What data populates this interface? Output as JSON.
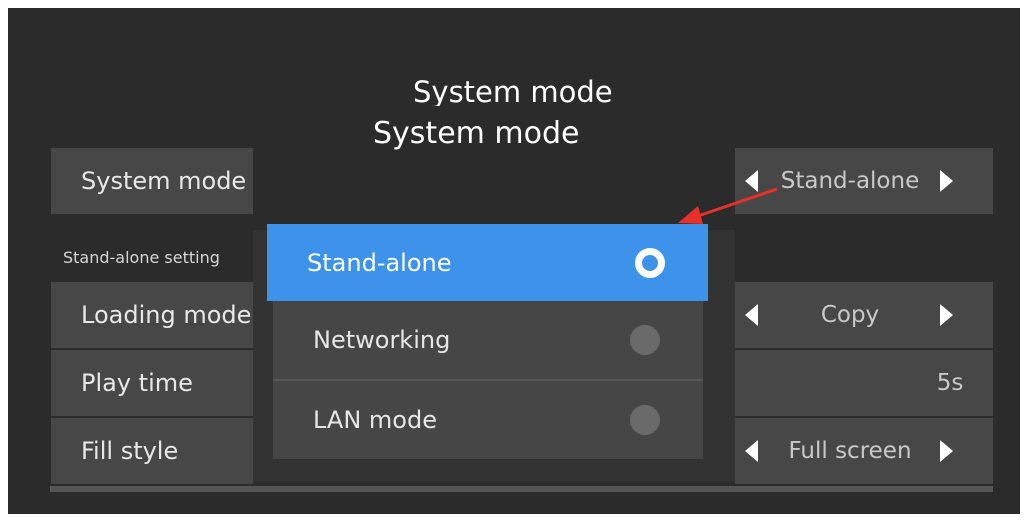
{
  "titles": {
    "top": "System mode",
    "main": "System mode"
  },
  "rows": {
    "system_mode": {
      "label": "System mode",
      "value": "Stand-alone"
    },
    "section": "Stand-alone setting",
    "loading_mode": {
      "label": "Loading mode",
      "value": "Copy"
    },
    "play_time": {
      "label": "Play time",
      "value": "5s"
    },
    "fill_style": {
      "label": "Fill style",
      "value": "Full screen"
    }
  },
  "dialog": {
    "options": [
      {
        "label": "Stand-alone",
        "selected": true
      },
      {
        "label": "Networking",
        "selected": false
      },
      {
        "label": "LAN mode",
        "selected": false
      }
    ]
  },
  "colors": {
    "accent": "#3d92ea",
    "annotation_arrow": "#e8302a"
  },
  "icons": {
    "left": "triangle-left",
    "right": "triangle-right",
    "radio_on": "radio-selected",
    "radio_off": "radio-unselected"
  }
}
